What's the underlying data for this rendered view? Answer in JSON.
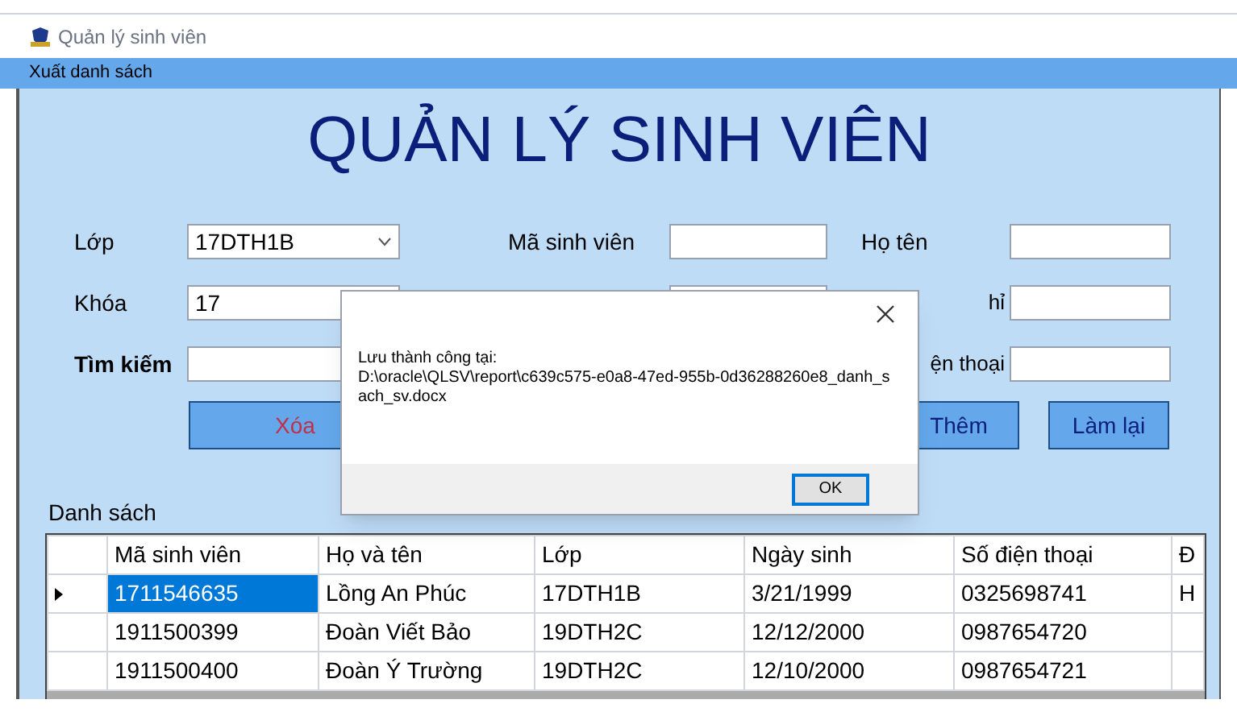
{
  "window": {
    "title": "Quản lý sinh viên"
  },
  "menu": [
    "Xuất danh sách"
  ],
  "heading": "QUẢN LÝ SINH VIÊN",
  "filters": [
    {
      "label": "Lớp",
      "kind": "dropdown",
      "value": "17DTH1B",
      "bold": false
    },
    {
      "label": "Khóa",
      "kind": "text",
      "value": "17",
      "bold": false
    },
    {
      "label": "Tìm kiếm",
      "kind": "text",
      "bold": true
    }
  ],
  "fields_middle": [
    {
      "label": "Mã sinh viên",
      "kind": "labeled"
    },
    {
      "kind": "unlabeled"
    }
  ],
  "fields_right": [
    {
      "label": "Họ tên",
      "kind": "full"
    },
    {
      "label": "hỉ",
      "kind": "clipped"
    },
    {
      "label": "ện thoại",
      "kind": "clipped"
    }
  ],
  "buttons": [
    {
      "label": "Xóa",
      "kind": "danger"
    },
    {
      "label": "Thêm",
      "kind": "normal"
    },
    {
      "label": "Làm lại",
      "kind": "normal"
    }
  ],
  "list_title": "Danh sách",
  "table": {
    "columns": [
      "Mã sinh viên",
      "Họ và tên",
      "Lớp",
      "Ngày sinh",
      "Số điện thoại",
      "Đ"
    ],
    "rows": [
      {
        "selected": true,
        "cells": [
          "1711546635",
          "Lồng An Phúc",
          "17DTH1B",
          "3/21/1999",
          "0325698741",
          "H"
        ]
      },
      {
        "selected": false,
        "cells": [
          "1911500399",
          "Đoàn Viết Bảo",
          "19DTH2C",
          "12/12/2000",
          "0987654720",
          ""
        ]
      },
      {
        "selected": false,
        "cells": [
          "1911500400",
          "Đoàn Ý Trường",
          "19DTH2C",
          "12/10/2000",
          "0987654721",
          ""
        ]
      }
    ]
  },
  "dialog": {
    "message_lines": [
      "Lưu thành công tại:",
      "D:\\oracle\\QLSV\\report\\c639c575-e0a8-47ed-955b-0d36288260e8_danh_s",
      "ach_sv.docx"
    ],
    "button": "OK"
  }
}
